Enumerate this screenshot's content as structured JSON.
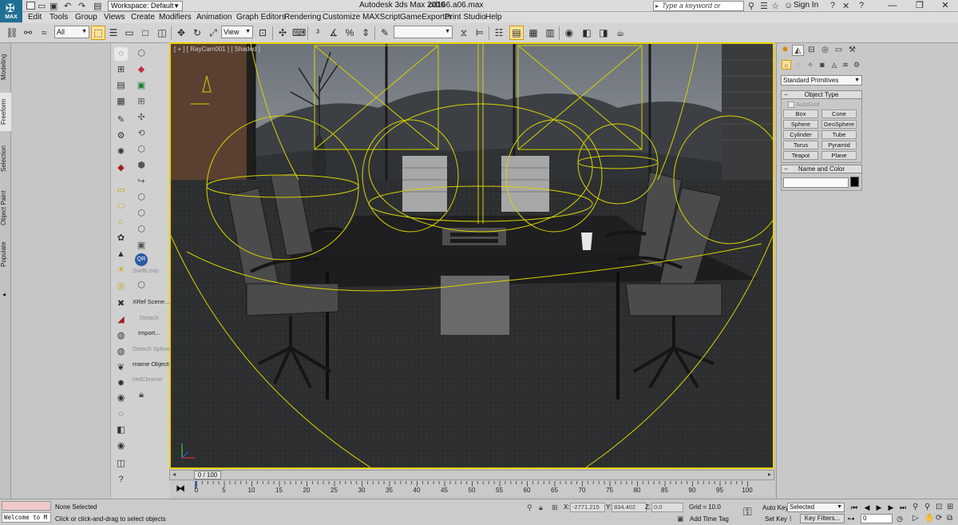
{
  "titlebar": {
    "workspace": "Workspace: Default",
    "app_title": "Autodesk 3ds Max 2016",
    "file_name": "cd166.a06.max",
    "search_placeholder": "Type a keyword or phrase",
    "sign_in": "Sign In"
  },
  "menu": [
    "Edit",
    "Tools",
    "Group",
    "Views",
    "Create",
    "Modifiers",
    "Animation",
    "Graph Editors",
    "Rendering",
    "Customize",
    "MAXScript",
    "GameExporter",
    "Print Studio",
    "Help"
  ],
  "toolbar": {
    "selection_filter": "All",
    "ref_coord": "View"
  },
  "ribbon_tabs": [
    "Modeling",
    "Freeform",
    "Selection",
    "Object Paint",
    "Populate"
  ],
  "palette_labels": {
    "swiftloop": "SwiftLoop",
    "xref": "XRef Scene...",
    "detach": "Detach",
    "import": "Import...",
    "detach_splines": "Detach Spline",
    "rename": "rname Objects",
    "helcleaner": "HelCleaner"
  },
  "viewport": {
    "label": "[ + ] [ RayCam001 ] [ Shaded ]"
  },
  "timeline": {
    "frame_indicator": "0 / 100",
    "ticks": [
      "0",
      "5",
      "10",
      "15",
      "20",
      "25",
      "30",
      "35",
      "40",
      "45",
      "50",
      "55",
      "60",
      "65",
      "70",
      "75",
      "80",
      "85",
      "90",
      "95",
      "100"
    ]
  },
  "command_panel": {
    "category": "Standard Primitives",
    "object_type_title": "Object Type",
    "autogrid": "AutoGrid",
    "primitives": [
      "Box",
      "Cone",
      "Sphere",
      "GeoSphere",
      "Cylinder",
      "Tube",
      "Torus",
      "Pyramid",
      "Teapot",
      "Plane"
    ],
    "name_color_title": "Name and Color"
  },
  "status": {
    "listener_text": "Welcome to M",
    "selection": "None Selected",
    "prompt": "Click or click-and-drag to select objects",
    "x_label": "X:",
    "x_value": "-2771.215",
    "y_label": "Y:",
    "y_value": "834.402",
    "z_label": "Z:",
    "z_value": "0.0",
    "grid": "Grid = 10.0",
    "add_time_tag": "Add Time Tag",
    "auto_key": "Auto Key",
    "set_key": "Set Key",
    "selected_dd": "Selected",
    "key_filters": "Key Filters...",
    "frame": "0"
  },
  "colors": {
    "viewport_border": "#e8d000",
    "active_tool": "#ffe39a",
    "wire": "#d8d200",
    "logo": "#1f6f94"
  }
}
